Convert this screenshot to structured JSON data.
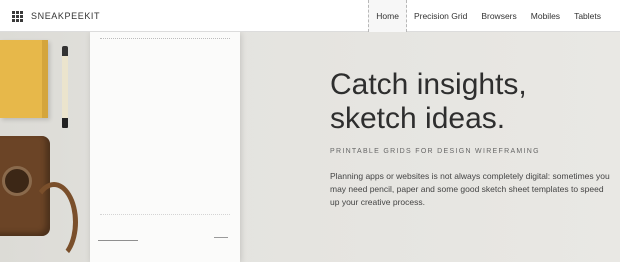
{
  "brand": {
    "name": "SNEAKPEEKIT"
  },
  "nav": {
    "items": [
      {
        "label": "Home",
        "active": true
      },
      {
        "label": "Precision Grid",
        "active": false
      },
      {
        "label": "Browsers",
        "active": false
      },
      {
        "label": "Mobiles",
        "active": false
      },
      {
        "label": "Tablets",
        "active": false
      }
    ]
  },
  "hero": {
    "headline_line1": "Catch insights,",
    "headline_line2": "sketch ideas.",
    "subtitle": "PRINTABLE GRIDS FOR DESIGN WIREFRAMING",
    "description": "Planning apps or websites is not always completely digital: sometimes you may need pencil, paper and some good sketch sheet templates to speed up your creative process."
  },
  "icons": {
    "brand": "grid-icon"
  },
  "colors": {
    "accent_book": "#e7b84a",
    "text_dark": "#2e2e2e"
  }
}
